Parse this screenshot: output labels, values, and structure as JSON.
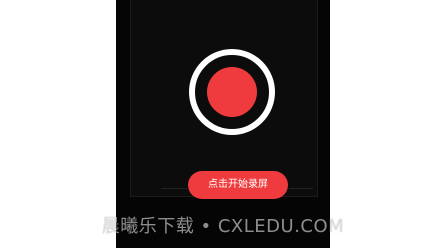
{
  "screen": {
    "button_label": "点击开始录屏"
  },
  "watermark": {
    "text": "晨曦乐下载 • CXLEDU.COM"
  },
  "colors": {
    "background": "#050505",
    "accent_red": "#ef3b3d",
    "ring": "#ffffff"
  },
  "icons": {
    "record": "record-icon"
  }
}
